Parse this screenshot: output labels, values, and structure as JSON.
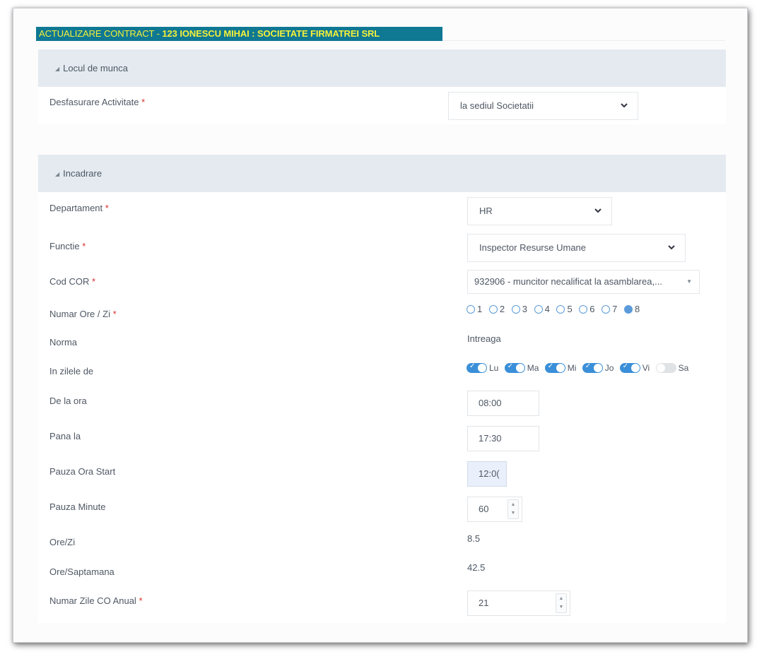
{
  "title": {
    "prefix": "ACTUALIZARE CONTRACT - ",
    "subject": "123 IONESCU MIHAI : SOCIETATE FIRMATREI SRL"
  },
  "section_loc": {
    "heading": "Locul de munca",
    "desfasurare_label": "Desfasurare Activitate",
    "desfasurare_value": "la sediul Societatii"
  },
  "section_incadrare": {
    "heading": "Incadrare",
    "departament_label": "Departament",
    "departament_value": "HR",
    "functie_label": "Functie",
    "functie_value": "Inspector Resurse Umane",
    "cod_cor_label": "Cod COR",
    "cod_cor_value": "932906 - muncitor necalificat la asamblarea,...",
    "ore_zi_label": "Numar Ore / Zi",
    "ore_options": [
      "1",
      "2",
      "3",
      "4",
      "5",
      "6",
      "7",
      "8"
    ],
    "ore_selected": "8",
    "norma_label": "Norma",
    "norma_value": "Intreaga",
    "zile_label": "In zilele de",
    "zile": [
      {
        "label": "Lu",
        "on": true
      },
      {
        "label": "Ma",
        "on": true
      },
      {
        "label": "Mi",
        "on": true
      },
      {
        "label": "Jo",
        "on": true
      },
      {
        "label": "Vi",
        "on": true
      },
      {
        "label": "Sa",
        "on": false
      }
    ],
    "de_la_label": "De la ora",
    "de_la_value": "08:00",
    "pana_label": "Pana la",
    "pana_value": "17:30",
    "pauza_start_label": "Pauza Ora Start",
    "pauza_start_value": "12:0(",
    "pauza_min_label": "Pauza Minute",
    "pauza_min_value": "60",
    "ore_zi_calc_label": "Ore/Zi",
    "ore_zi_calc_value": "8.5",
    "ore_sapt_label": "Ore/Saptamana",
    "ore_sapt_value": "42.5",
    "zile_co_label": "Numar Zile CO Anual",
    "zile_co_value": "21"
  },
  "required_mark": "*",
  "colors": {
    "title_bg": "#0f7893",
    "title_text": "#f5f03a",
    "section_bg": "#e4eaf0",
    "accent": "#3a8fd8",
    "required": "#d9302c"
  }
}
